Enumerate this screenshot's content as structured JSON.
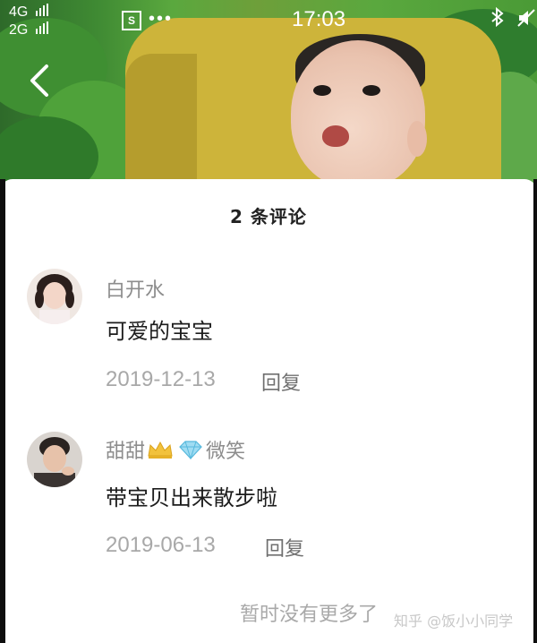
{
  "status_bar": {
    "network_1": "4G",
    "network_2": "2G",
    "time": "17:03",
    "icons": [
      "signal-icon",
      "s-app-icon",
      "more-dots-icon",
      "bluetooth-icon",
      "mute-icon"
    ]
  },
  "sheet": {
    "title": "2 条评论",
    "no_more": "暂时没有更多了"
  },
  "comments": [
    {
      "username": "白开水",
      "text": "可爱的宝宝",
      "date": "2019-12-13",
      "reply_label": "回复"
    },
    {
      "username_prefix": "甜甜",
      "username_suffix": "微笑",
      "badges": [
        "crown-icon",
        "diamond-icon"
      ],
      "text": "带宝贝出来散步啦",
      "date": "2019-06-13",
      "reply_label": "回复"
    }
  ],
  "watermark": "知乎 @饭小小同学",
  "colors": {
    "sheet_bg": "#ffffff",
    "username": "#8d8d8d",
    "text": "#1c1c1c",
    "muted": "#a8a8a8"
  }
}
